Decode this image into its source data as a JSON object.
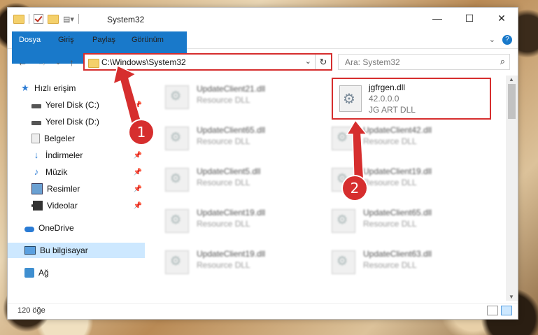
{
  "window": {
    "title": "System32",
    "controls": {
      "minimize": "—",
      "maximize": "☐",
      "close": "✕"
    }
  },
  "ribbon": {
    "tabs": [
      "Dosya",
      "Giriş",
      "Paylaş",
      "Görünüm"
    ],
    "expand_icon": "chevron-down",
    "help": "?"
  },
  "address": {
    "path": "C:\\Windows\\System32",
    "search_placeholder": "Ara: System32"
  },
  "sidebar": {
    "items": [
      {
        "label": "Hızlı erişim",
        "icon": "star-icon",
        "pinned": false
      },
      {
        "label": "Yerel Disk (C:)",
        "icon": "disk-icon",
        "pinned": true
      },
      {
        "label": "Yerel Disk (D:)",
        "icon": "disk-icon",
        "pinned": true
      },
      {
        "label": "Belgeler",
        "icon": "documents-icon",
        "pinned": true
      },
      {
        "label": "İndirmeler",
        "icon": "download-icon",
        "pinned": true
      },
      {
        "label": "Müzik",
        "icon": "music-icon",
        "pinned": true
      },
      {
        "label": "Resimler",
        "icon": "pictures-icon",
        "pinned": true
      },
      {
        "label": "Videolar",
        "icon": "videos-icon",
        "pinned": true
      },
      {
        "label": "OneDrive",
        "icon": "onedrive-icon",
        "pinned": false
      },
      {
        "label": "Bu bilgisayar",
        "icon": "pc-icon",
        "pinned": false
      },
      {
        "label": "Ağ",
        "icon": "network-icon",
        "pinned": false
      }
    ]
  },
  "files": {
    "left_column": [
      {
        "name": "UpdateClient21.dll",
        "type": "Resource DLL"
      },
      {
        "name": "UpdateClient65.dll",
        "type": "Resource DLL"
      },
      {
        "name": "UpdateClient5.dll",
        "type": "Resource DLL"
      },
      {
        "name": "UpdateClient19.dll",
        "type": "Resource DLL"
      },
      {
        "name": "UpdateClient19.dll",
        "type": "Resource DLL"
      }
    ],
    "right_column": [
      {
        "name": "UpdateClient42.dll",
        "type": "Resource DLL"
      },
      {
        "name": "UpdateClient19.dll",
        "type": "Resource DLL"
      },
      {
        "name": "UpdateClient65.dll",
        "type": "Resource DLL"
      },
      {
        "name": "UpdateClient63.dll",
        "type": "Resource DLL"
      }
    ],
    "highlighted": {
      "name": "jgfrgen.dll",
      "version": "42.0.0.0",
      "description": "JG ART DLL"
    }
  },
  "status": {
    "count": "120 öğe"
  },
  "annotations": {
    "badge1": "1",
    "badge2": "2",
    "color": "#d62e2e"
  }
}
